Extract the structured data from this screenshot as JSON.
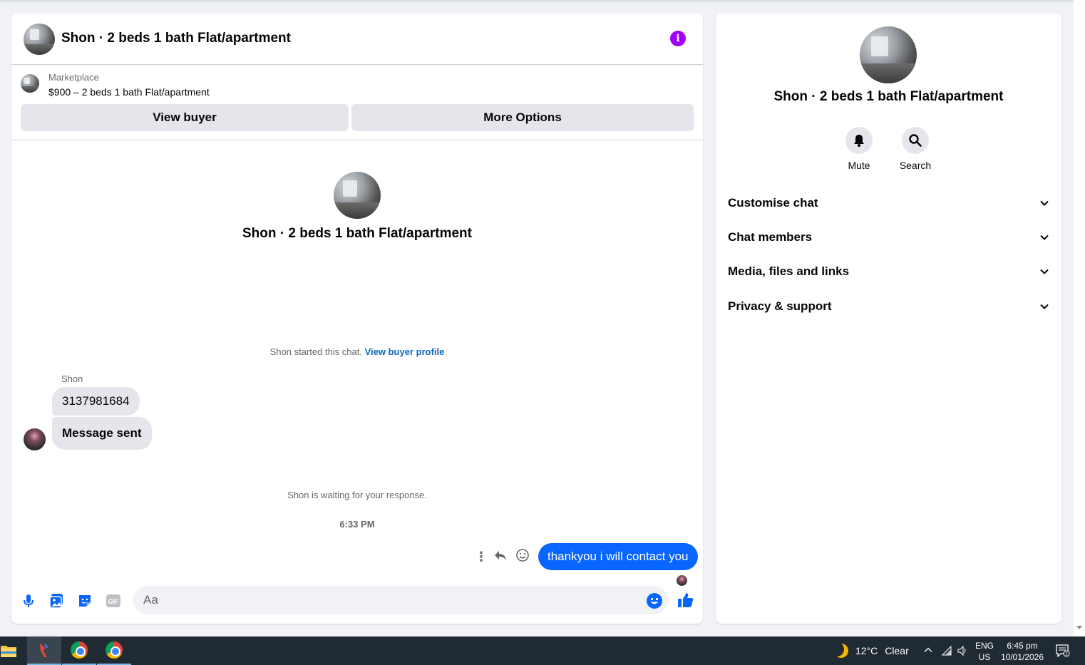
{
  "chat": {
    "title": "Shon · 2 beds 1 bath Flat/apartment",
    "listing": {
      "source": "Marketplace",
      "title": "$900 – 2 beds 1 bath Flat/apartment"
    },
    "buttons": {
      "view_buyer": "View buyer",
      "more_options": "More Options"
    },
    "intro_title": "Shon · 2 beds 1 bath Flat/apartment",
    "started_text": "Shon started this chat.",
    "started_link": "View buyer profile",
    "sender_name": "Shon",
    "messages_in": [
      "3137981684",
      "Message sent"
    ],
    "waiting_text": "Shon is waiting for your response.",
    "timestamp": "6:33 PM",
    "message_out": "thankyou i will contact you",
    "composer_placeholder": "Aa"
  },
  "details": {
    "title": "Shon · 2 beds 1 bath Flat/apartment",
    "actions": {
      "mute": "Mute",
      "search": "Search"
    },
    "sections": [
      "Customise chat",
      "Chat members",
      "Media, files and links",
      "Privacy & support"
    ]
  },
  "taskbar": {
    "weather": {
      "temp": "12°C",
      "condition": "Clear"
    },
    "language": "ENG",
    "region": "US",
    "time": "6:45 pm",
    "date": "10/01/2026",
    "notification_count": "1"
  },
  "colors": {
    "accent_blue": "#0866ff",
    "info_purple": "#a100ff",
    "link_blue": "#0a66c2"
  },
  "icons": [
    "info-icon",
    "mic-icon",
    "photo-icon",
    "sticker-icon",
    "gif-icon",
    "emoji-icon",
    "like-icon",
    "bell-icon",
    "search-icon",
    "chevron-down-icon",
    "reply-icon",
    "react-icon",
    "more-dots-icon"
  ]
}
